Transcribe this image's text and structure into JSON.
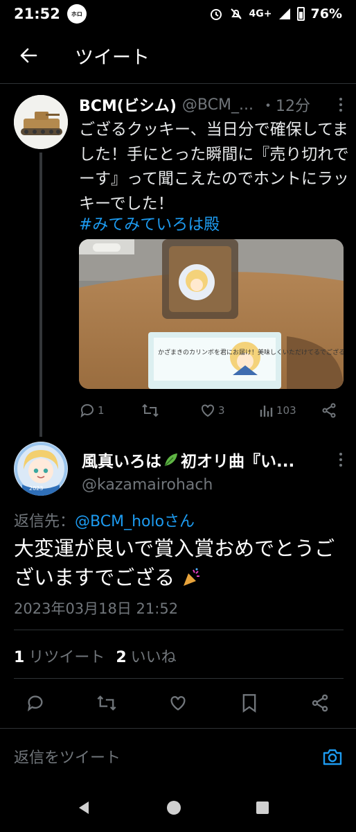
{
  "status_bar": {
    "time": "21:52",
    "app_icon": "hololive-app-icon",
    "network": "4G+",
    "battery": "76%"
  },
  "header": {
    "title": "ツイート"
  },
  "parent_tweet": {
    "name": "BCM(ビシム)",
    "handle": "@BCM_...",
    "time": "・12分",
    "text": "ござるクッキー、当日分で確保してました！手にとった瞬間に『売り切れでーす』って聞こえたのでホントにラッキーでした！",
    "hashtag": "#みてみていろは殿",
    "photo_card_text": "かざまきのカリンボを君にお届け！美味しくいただけてるでござる",
    "stats": {
      "replies": "1",
      "retweets": "",
      "likes": "3",
      "views": "103"
    }
  },
  "reply_tweet": {
    "name": "風真いろは",
    "name_rest": "初オリ曲『い...",
    "handle": "@kazamairohach",
    "replying_to_prefix": "返信先：",
    "replying_to_mention": "@BCM_holoさん",
    "text": "大変運が良いで賞入賞おめでとうございますでござる",
    "timestamp": "2023年03月18日 21:52",
    "retweet_count": "1",
    "retweet_label": "リツイート",
    "like_count": "2",
    "like_label": "いいね"
  },
  "reply_bar": {
    "placeholder": "返信をツイート"
  },
  "colors": {
    "accent": "#1d9bf0",
    "secondary_text": "#71767b",
    "background": "#000000"
  }
}
